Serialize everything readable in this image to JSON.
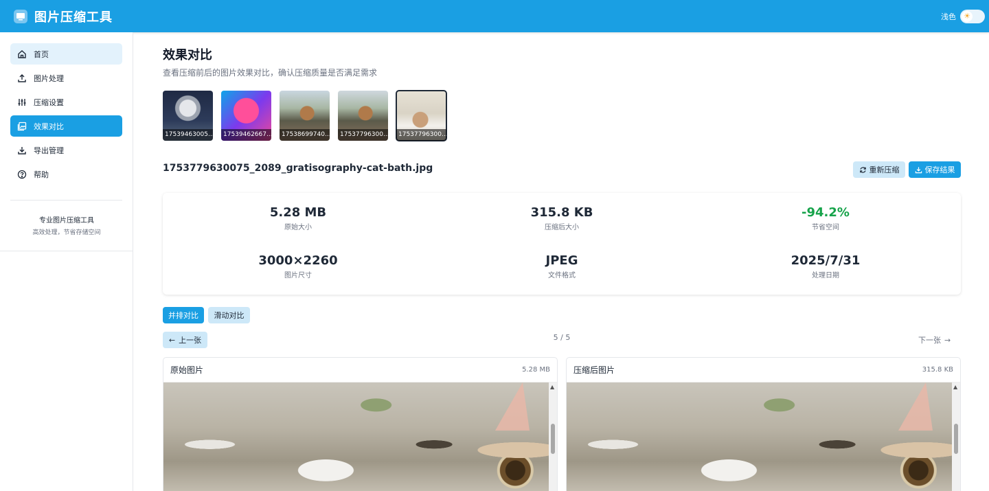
{
  "header": {
    "title": "图片压缩工具",
    "theme_label": "浅色",
    "theme_icon": "sun-icon"
  },
  "sidebar": {
    "items": [
      {
        "label": "首页",
        "icon": "home-icon"
      },
      {
        "label": "图片处理",
        "icon": "upload-icon"
      },
      {
        "label": "压缩设置",
        "icon": "sliders-icon"
      },
      {
        "label": "效果对比",
        "icon": "image-compare-icon"
      },
      {
        "label": "导出管理",
        "icon": "download-icon"
      },
      {
        "label": "帮助",
        "icon": "help-icon"
      }
    ],
    "active_index": 3,
    "footer_title": "专业图片压缩工具",
    "footer_subtitle": "高效处理，节省存储空间"
  },
  "main": {
    "title": "效果对比",
    "description": "查看压缩前后的图片效果对比，确认压缩质量是否满足需求",
    "thumbnails": [
      {
        "label": "17539463005..."
      },
      {
        "label": "17539462667..."
      },
      {
        "label": "17538699740..."
      },
      {
        "label": "17537796300..."
      },
      {
        "label": "17537796300..."
      }
    ],
    "selected_thumbnail": 4,
    "file_name": "1753779630075_2089_gratisography-cat-bath.jpg",
    "recompress_label": "重新压缩",
    "save_label": "保存结果",
    "stats": {
      "original_size": "5.28 MB",
      "original_size_label": "原始大小",
      "compressed_size": "315.8 KB",
      "compressed_size_label": "压缩后大小",
      "saved": "-94.2%",
      "saved_label": "节省空间",
      "dimensions": "3000×2260",
      "dimensions_label": "图片尺寸",
      "format": "JPEG",
      "format_label": "文件格式",
      "date": "2025/7/31",
      "date_label": "处理日期"
    },
    "mode_side_label": "并排对比",
    "mode_slide_label": "滑动对比",
    "prev_label": "上一张",
    "pager": "5 / 5",
    "next_label": "下一张",
    "left_panel": {
      "title": "原始图片",
      "size": "5.28 MB"
    },
    "right_panel": {
      "title": "压缩后图片",
      "size": "315.8 KB"
    }
  },
  "colors": {
    "primary": "#1a9fe3",
    "primary_light": "#cde8f8",
    "success": "#16a34a"
  }
}
